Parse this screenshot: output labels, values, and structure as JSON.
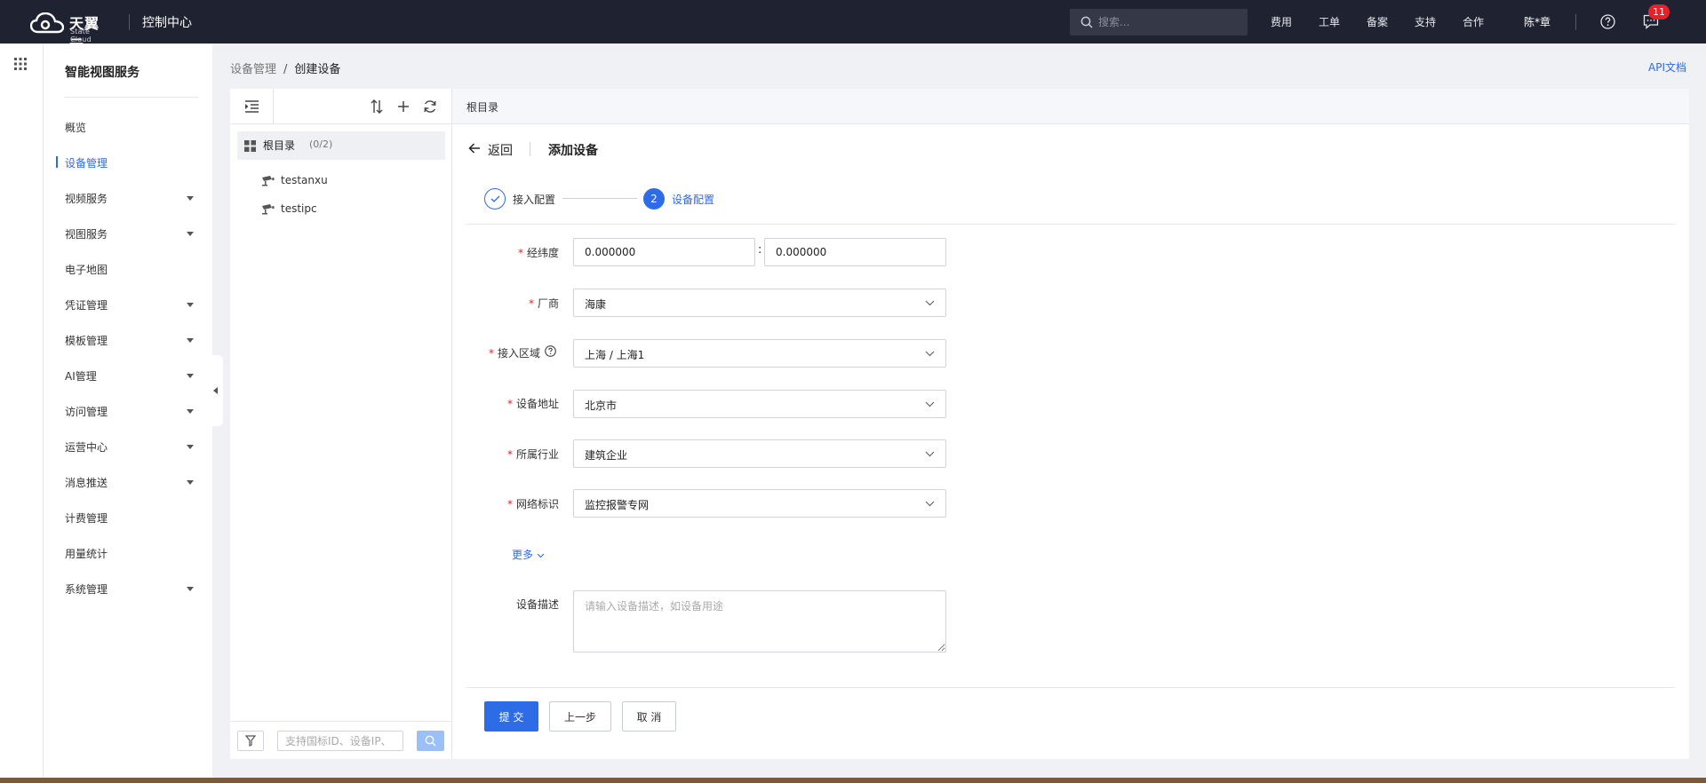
{
  "topbar": {
    "brand_name": "天翼云",
    "brand_sub": "State Cloud",
    "console_title": "控制中心",
    "search_placeholder": "搜索...",
    "nav": [
      "费用",
      "工单",
      "备案",
      "支持",
      "合作"
    ],
    "user_name": "陈*章",
    "message_count": "11"
  },
  "sidebar": {
    "title": "智能视图服务",
    "items": [
      {
        "label": "概览",
        "has_children": false,
        "active": false
      },
      {
        "label": "设备管理",
        "has_children": false,
        "active": true
      },
      {
        "label": "视频服务",
        "has_children": true,
        "active": false
      },
      {
        "label": "视图服务",
        "has_children": true,
        "active": false
      },
      {
        "label": "电子地图",
        "has_children": false,
        "active": false
      },
      {
        "label": "凭证管理",
        "has_children": true,
        "active": false
      },
      {
        "label": "模板管理",
        "has_children": true,
        "active": false
      },
      {
        "label": "AI管理",
        "has_children": true,
        "active": false
      },
      {
        "label": "访问管理",
        "has_children": true,
        "active": false
      },
      {
        "label": "运营中心",
        "has_children": true,
        "active": false
      },
      {
        "label": "消息推送",
        "has_children": true,
        "active": false
      },
      {
        "label": "计费管理",
        "has_children": false,
        "active": false
      },
      {
        "label": "用量统计",
        "has_children": false,
        "active": false
      },
      {
        "label": "系统管理",
        "has_children": true,
        "active": false
      }
    ]
  },
  "breadcrumb": {
    "parent": "设备管理",
    "separator": "/",
    "current": "创建设备"
  },
  "api_doc_link": "API文档",
  "tree": {
    "root_label": "根目录",
    "root_count": "(0/2)",
    "nodes": [
      "testanxu",
      "testipc"
    ],
    "search_placeholder": "支持国标ID、设备IP、"
  },
  "form": {
    "path_label": "根目录",
    "back_label": "返回",
    "title": "添加设备",
    "steps": [
      {
        "label": "接入配置",
        "status": "done"
      },
      {
        "label": "设备配置",
        "number": "2",
        "status": "active"
      }
    ],
    "fields": {
      "latlng": {
        "label": "经纬度",
        "required": true,
        "lng_value": "0.000000",
        "colon": ":",
        "lat_value": "0.000000"
      },
      "vendor": {
        "label": "厂商",
        "required": true,
        "value": "海康"
      },
      "region": {
        "label": "接入区域",
        "required": true,
        "value": "上海 / 上海1"
      },
      "address": {
        "label": "设备地址",
        "required": true,
        "value": "北京市"
      },
      "industry": {
        "label": "所属行业",
        "required": true,
        "value": "建筑企业"
      },
      "network": {
        "label": "网络标识",
        "required": true,
        "value": "监控报警专网"
      },
      "description": {
        "label": "设备描述",
        "required": false,
        "placeholder": "请输入设备描述，如设备用途"
      }
    },
    "more_label": "更多",
    "buttons": {
      "submit": "提 交",
      "prev": "上一步",
      "cancel": "取 消"
    }
  },
  "colors": {
    "topbar_bg": "#1f2230",
    "accent": "#2e6be6",
    "required": "#e5222b",
    "badge": "#e5222b"
  }
}
